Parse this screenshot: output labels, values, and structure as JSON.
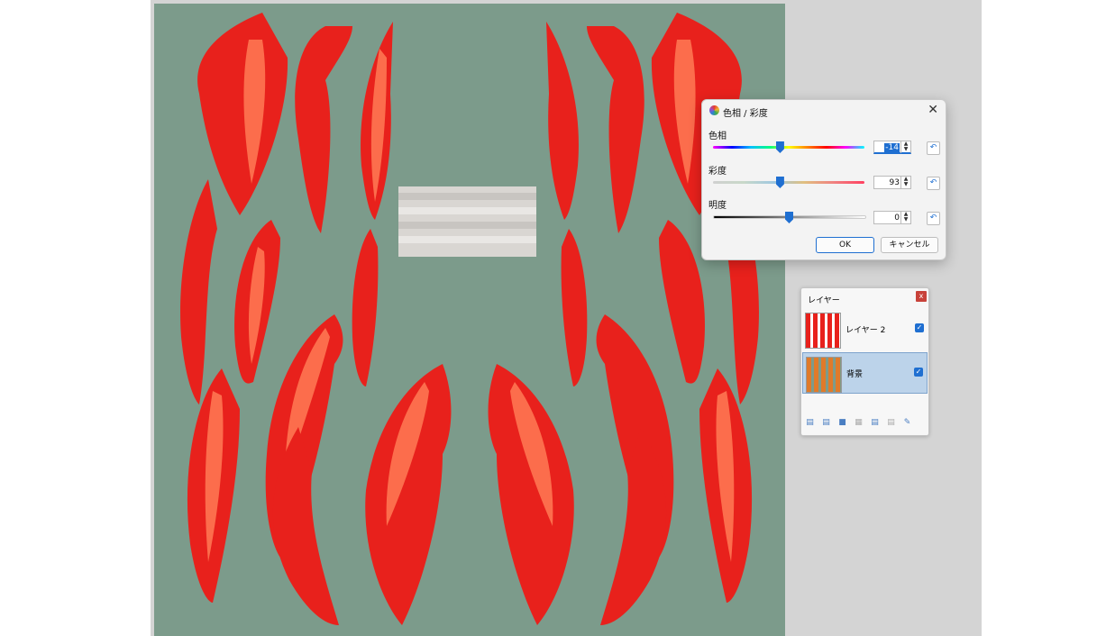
{
  "dialog": {
    "title": "色相 / 彩度",
    "close_glyph": "✕",
    "hue": {
      "label": "色相",
      "value": "-14",
      "level_percent": 44
    },
    "saturation": {
      "label": "彩度",
      "value": "93",
      "level_percent": 44
    },
    "lightness": {
      "label": "明度",
      "value": "0",
      "level_percent": 50
    },
    "spin_up": "▲",
    "spin_down": "▼",
    "reset_glyph": "↶",
    "ok_label": "OK",
    "cancel_label": "キャンセル"
  },
  "layers_panel": {
    "title": "レイヤー",
    "close_glyph": "x",
    "layers": [
      {
        "name": "レイヤー 2",
        "visible": true,
        "selected": false
      },
      {
        "name": "背景",
        "visible": true,
        "selected": true
      }
    ],
    "check_glyph": "✓",
    "tools": [
      "add-layer-icon",
      "delete-layer-icon",
      "duplicate-layer-icon",
      "merge-layer-icon",
      "move-up-icon",
      "move-down-icon",
      "properties-icon"
    ]
  },
  "colors": {
    "canvas_bg": "#7c9b8b",
    "petal": "#e8211c",
    "accent": "#1f6fd1"
  }
}
